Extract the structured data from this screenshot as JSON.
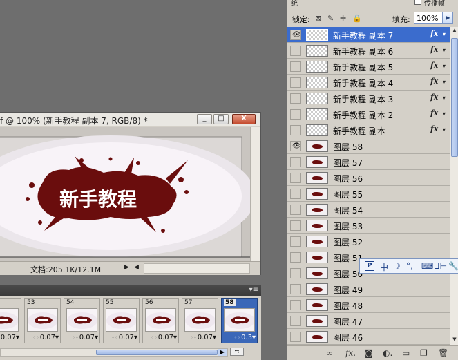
{
  "document": {
    "title": "f @ 100% (新手教程 副本 7, RGB/8) *",
    "window_buttons": {
      "minimize": "_",
      "maximize": "□",
      "close": "X"
    },
    "artwork_text": "新手教程",
    "status_text": "文档:205.1K/12.1M",
    "status_arrow": "▶",
    "scroll_left_arrow": "◀"
  },
  "animation": {
    "menu_icon": "▾≡",
    "frames": [
      {
        "number": "",
        "delay": "0.07"
      },
      {
        "number": "53",
        "delay": "0.07"
      },
      {
        "number": "54",
        "delay": "0.07"
      },
      {
        "number": "55",
        "delay": "0.07"
      },
      {
        "number": "56",
        "delay": "0.07"
      },
      {
        "number": "57",
        "delay": "0.07"
      },
      {
        "number": "58",
        "delay": "0.3"
      }
    ],
    "scroll_right": "▶"
  },
  "layers": {
    "top_label": "统",
    "top_right_label": "传播帧",
    "lock_label": "锁定:",
    "fill_label": "填充:",
    "fill_value": "100%",
    "rows": [
      {
        "name": "新手教程 副本 7",
        "visible": true,
        "fx": true,
        "art": false,
        "selected": true
      },
      {
        "name": "新手教程 副本 6",
        "visible": false,
        "fx": true,
        "art": false,
        "selected": false
      },
      {
        "name": "新手教程 副本 5",
        "visible": false,
        "fx": true,
        "art": false,
        "selected": false
      },
      {
        "name": "新手教程 副本 4",
        "visible": false,
        "fx": true,
        "art": false,
        "selected": false
      },
      {
        "name": "新手教程 副本 3",
        "visible": false,
        "fx": true,
        "art": false,
        "selected": false
      },
      {
        "name": "新手教程 副本 2",
        "visible": false,
        "fx": true,
        "art": false,
        "selected": false
      },
      {
        "name": "新手教程 副本",
        "visible": false,
        "fx": true,
        "art": false,
        "selected": false
      },
      {
        "name": "图层 58",
        "visible": true,
        "fx": false,
        "art": true,
        "selected": false
      },
      {
        "name": "图层 57",
        "visible": false,
        "fx": false,
        "art": true,
        "selected": false
      },
      {
        "name": "图层 56",
        "visible": false,
        "fx": false,
        "art": true,
        "selected": false
      },
      {
        "name": "图层 55",
        "visible": false,
        "fx": false,
        "art": true,
        "selected": false
      },
      {
        "name": "图层 54",
        "visible": false,
        "fx": false,
        "art": true,
        "selected": false
      },
      {
        "name": "图层 53",
        "visible": false,
        "fx": false,
        "art": true,
        "selected": false
      },
      {
        "name": "图层 52",
        "visible": false,
        "fx": false,
        "art": true,
        "selected": false
      },
      {
        "name": "图层 51",
        "visible": false,
        "fx": false,
        "art": true,
        "selected": false
      },
      {
        "name": "图层 50",
        "visible": false,
        "fx": false,
        "art": true,
        "selected": false
      },
      {
        "name": "图层 49",
        "visible": false,
        "fx": false,
        "art": true,
        "selected": false
      },
      {
        "name": "图层 48",
        "visible": false,
        "fx": false,
        "art": true,
        "selected": false
      },
      {
        "name": "图层 47",
        "visible": false,
        "fx": false,
        "art": true,
        "selected": false
      },
      {
        "name": "图层 46",
        "visible": false,
        "fx": false,
        "art": true,
        "selected": false
      }
    ],
    "fx_label": "fx",
    "fx_arrow": "▾",
    "eye_icon": "👁",
    "scroll_up": "▲",
    "scroll_down": "▼",
    "bottom_icons": [
      "link-icon",
      "fx-icon",
      "mask-icon",
      "adjustment-icon",
      "folder-icon",
      "new-layer-icon",
      "trash-icon"
    ]
  },
  "ime": {
    "logo": "P",
    "items": [
      "中",
      "☽",
      "°,",
      "⌨",
      "⅃⊢",
      "🔧"
    ]
  },
  "colors": {
    "selection_blue": "#3b6ccd",
    "artwork_red": "#6a0d0d",
    "workspace_gray": "#6e6e6e"
  }
}
